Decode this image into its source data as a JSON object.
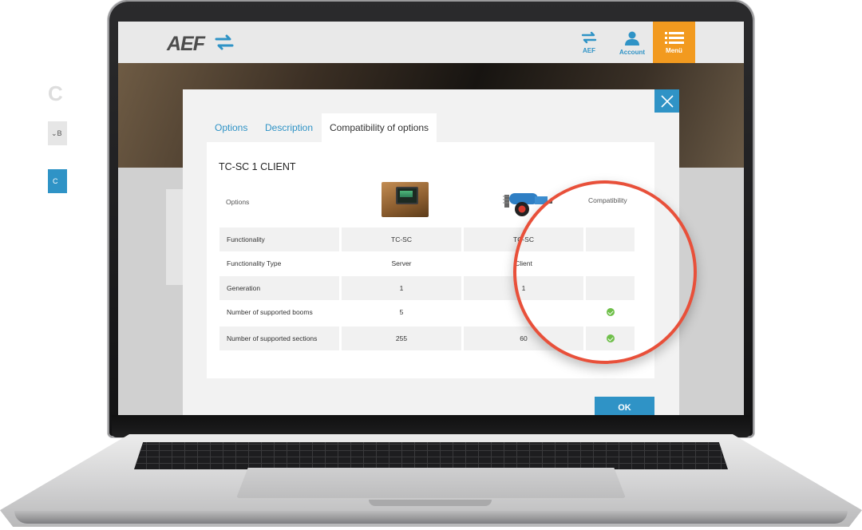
{
  "header": {
    "logo_text": "AEF",
    "nav": [
      {
        "label": "AEF",
        "icon": "swap-arrows-icon"
      },
      {
        "label": "Account",
        "icon": "user-icon"
      },
      {
        "label": "Menü",
        "icon": "hamburger-icon"
      }
    ]
  },
  "hero": {
    "title_fragment": "C"
  },
  "breadcrumb": {
    "fragment": "B"
  },
  "blue_bar": {
    "left_fragment": "C"
  },
  "modal": {
    "tabs": [
      {
        "label": "Options"
      },
      {
        "label": "Description"
      },
      {
        "label": "Compatibility of options",
        "active": true
      }
    ],
    "title": "TC-SC 1 CLIENT",
    "columns": {
      "options": "Options",
      "compatibility": "Compatibility"
    },
    "images": {
      "left": "terminal-device",
      "right": "sprayer-implement"
    },
    "rows": [
      {
        "label": "Functionality",
        "left": "TC-SC",
        "right": "TC-SC",
        "compatible": false
      },
      {
        "label": "Functionality Type",
        "left": "Server",
        "right": "Client",
        "compatible": false
      },
      {
        "label": "Generation",
        "left": "1",
        "right": "1",
        "compatible": false
      },
      {
        "label": "Number of supported booms",
        "left": "5",
        "right": "",
        "compatible": true
      },
      {
        "label": "Number of supported sections",
        "left": "255",
        "right": "60",
        "compatible": true
      }
    ],
    "ok_label": "OK"
  },
  "colors": {
    "accent": "#2f93c6",
    "menu": "#f29a1f",
    "highlight": "#e8503a",
    "check": "#6fbf4a"
  }
}
